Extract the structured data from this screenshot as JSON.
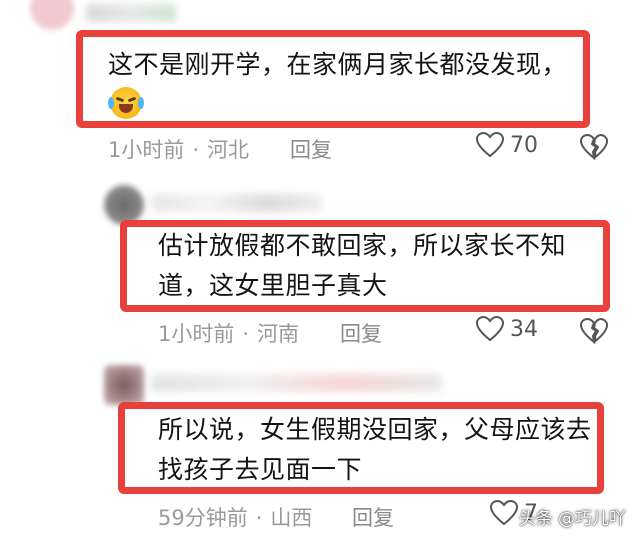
{
  "comments": [
    {
      "text_lines": [
        "这不是刚开学，在家俩月家长都没发现，"
      ],
      "emoji": "crying-laughing-emoji",
      "time": "1小时前",
      "location": "河北",
      "reply_label": "回复",
      "likes": "70"
    },
    {
      "text_lines": [
        "估计放假都不敢回家，所以家长不知",
        "道，这女里胆子真大"
      ],
      "time": "1小时前",
      "location": "河南",
      "reply_label": "回复",
      "likes": "34"
    },
    {
      "text_lines": [
        "所以说，女生假期没回家，父母应该去",
        "找孩子去见面一下"
      ],
      "time": "59分钟前",
      "location": "山西",
      "reply_label": "回复",
      "likes": "7"
    }
  ],
  "separator": "·",
  "watermark": "头条 @巧儿吖",
  "colors": {
    "highlight": "#e8403a",
    "meta": "#9a9a9a"
  }
}
